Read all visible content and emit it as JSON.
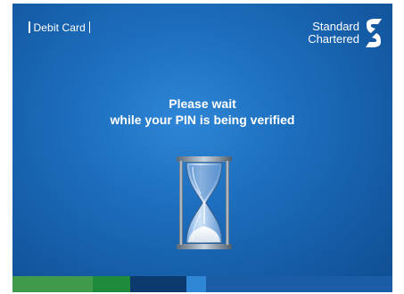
{
  "header": {
    "card_type": "Debit Card"
  },
  "brand": {
    "line1": "Standard",
    "line2": "Chartered",
    "logo_icon": "standard-chartered-logo-icon"
  },
  "status": {
    "line1": "Please wait",
    "line2": "while your PIN is being verified",
    "icon": "hourglass-icon"
  },
  "colors": {
    "background": "#1d6fbf",
    "text": "#ffffff",
    "stripe_green_light": "#3f9a4c",
    "stripe_green": "#1f8a3c",
    "stripe_navy": "#0d3a6e",
    "stripe_blue": "#1a6cc0",
    "stripe_blue_light": "#2e86d4"
  }
}
